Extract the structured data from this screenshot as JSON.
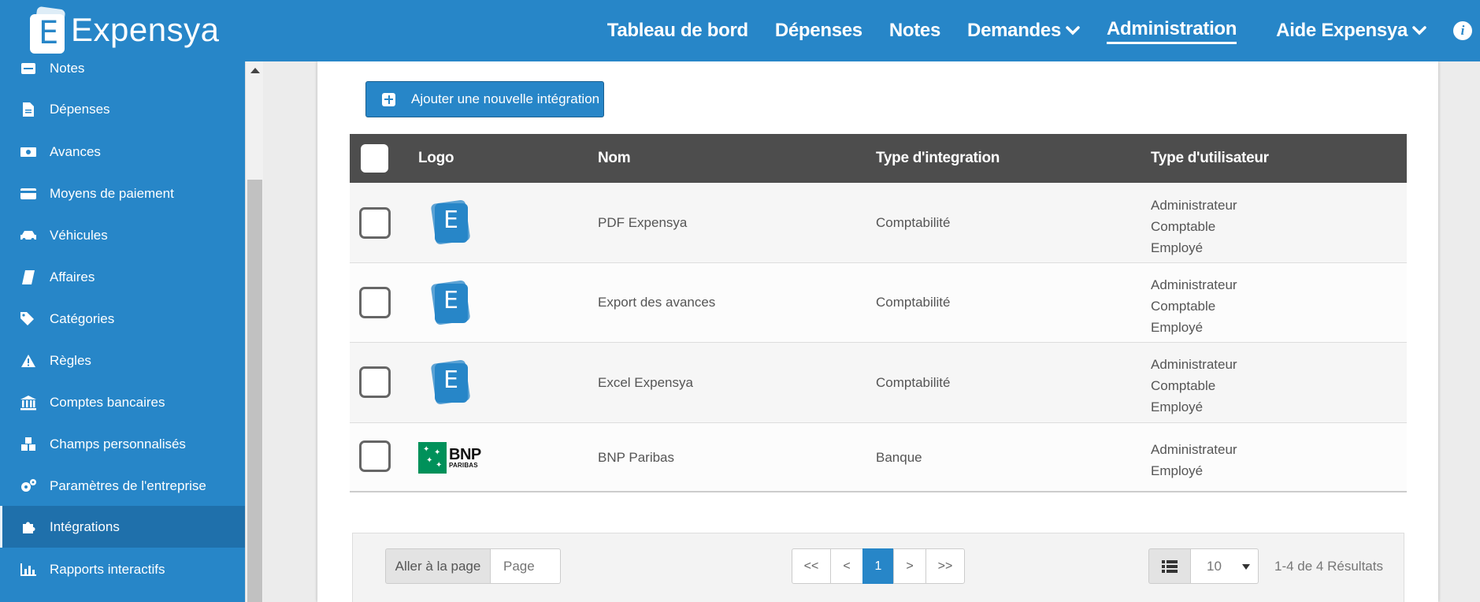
{
  "brand": {
    "name": "Expensya",
    "logo_letter": "E"
  },
  "nav": {
    "items": [
      {
        "label": "Tableau de bord"
      },
      {
        "label": "Dépenses"
      },
      {
        "label": "Notes"
      },
      {
        "label": "Demandes"
      },
      {
        "label": "Administration"
      },
      {
        "label": "Aide Expensya"
      }
    ],
    "active": "Administration"
  },
  "sidebar": {
    "items": [
      {
        "label": "Notes",
        "icon": "inbox-icon"
      },
      {
        "label": "Dépenses",
        "icon": "file-icon"
      },
      {
        "label": "Avances",
        "icon": "money-icon"
      },
      {
        "label": "Moyens de paiement",
        "icon": "credit-card-icon"
      },
      {
        "label": "Véhicules",
        "icon": "car-icon"
      },
      {
        "label": "Affaires",
        "icon": "book-icon"
      },
      {
        "label": "Catégories",
        "icon": "tags-icon"
      },
      {
        "label": "Règles",
        "icon": "warning-icon"
      },
      {
        "label": "Comptes bancaires",
        "icon": "bank-icon"
      },
      {
        "label": "Champs personnalisés",
        "icon": "cubes-icon"
      },
      {
        "label": "Paramètres de l'entreprise",
        "icon": "cogs-icon"
      },
      {
        "label": "Intégrations",
        "icon": "puzzle-icon"
      },
      {
        "label": "Rapports interactifs",
        "icon": "bar-chart-icon"
      }
    ],
    "active": "Intégrations"
  },
  "toolbar": {
    "add_label": "Ajouter une nouvelle intégration"
  },
  "table": {
    "columns": [
      "Logo",
      "Nom",
      "Type d'integration",
      "Type d'utilisateur"
    ],
    "rows": [
      {
        "logo": "expensya",
        "name": "PDF Expensya",
        "type": "Comptabilité",
        "users": [
          "Administrateur",
          "Comptable",
          "Employé"
        ]
      },
      {
        "logo": "expensya",
        "name": "Export des avances",
        "type": "Comptabilité",
        "users": [
          "Administrateur",
          "Comptable",
          "Employé"
        ]
      },
      {
        "logo": "expensya",
        "name": "Excel Expensya",
        "type": "Comptabilité",
        "users": [
          "Administrateur",
          "Comptable",
          "Employé"
        ]
      },
      {
        "logo": "bnp",
        "name": "BNP Paribas",
        "type": "Banque",
        "users": [
          "Administrateur",
          "Employé"
        ]
      }
    ],
    "bnp_logo": {
      "line1": "BNP",
      "line2": "PARIBAS"
    }
  },
  "pagination": {
    "goto_label": "Aller à la page",
    "page_placeholder": "Page",
    "buttons": [
      "<<",
      "<",
      "1",
      ">",
      ">>"
    ],
    "current_page": "1",
    "page_size": "10",
    "results": "1-4 de 4 Résultats"
  },
  "colors": {
    "primary": "#2786c8",
    "sidebar_active": "#1f70ab",
    "table_header": "#4d4d4d",
    "bnp_green": "#00915a"
  }
}
